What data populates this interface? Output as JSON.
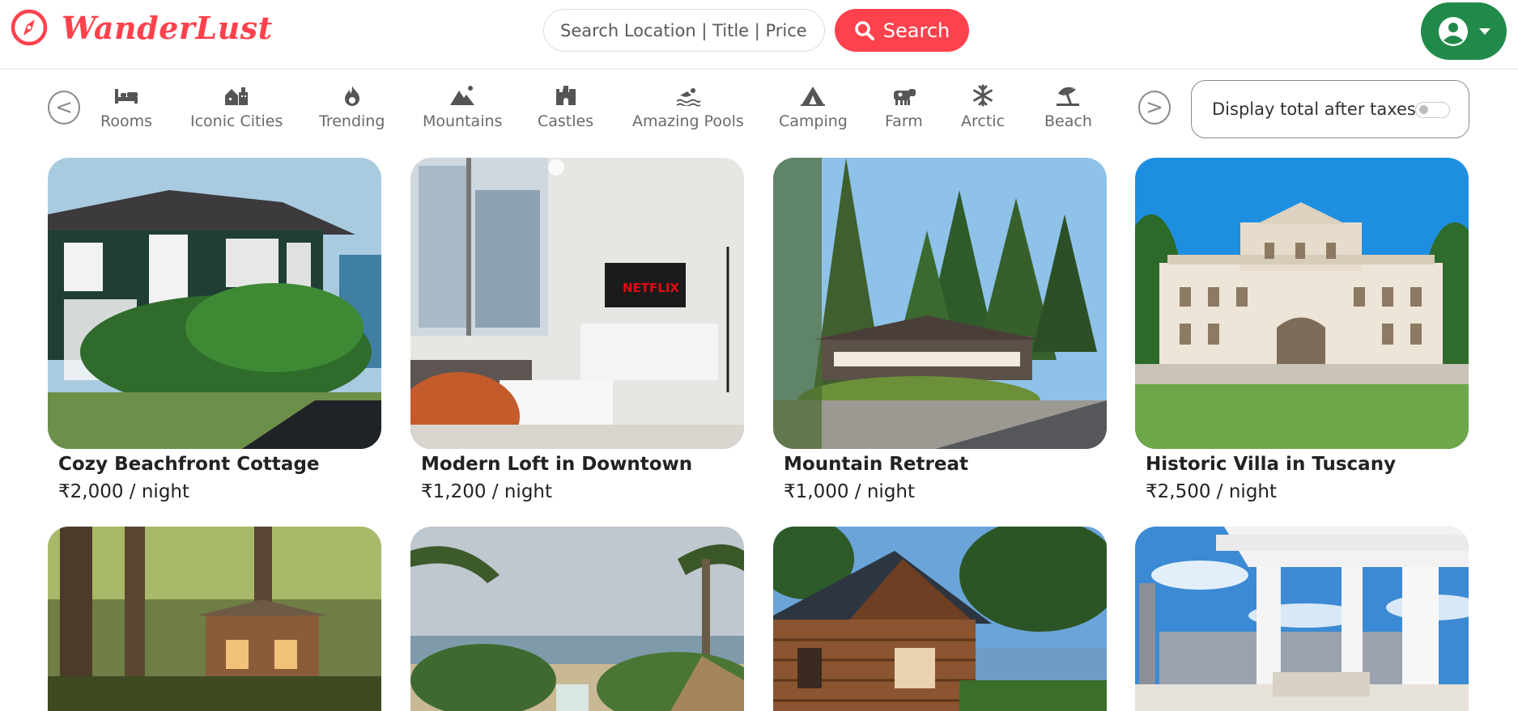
{
  "navbar": {
    "brand_name": "WanderLust",
    "search_placeholder": "Search Location | Title | Price",
    "search_button_label": "Search"
  },
  "filters": {
    "items": [
      {
        "label": "Rooms",
        "icon": "bed-icon"
      },
      {
        "label": "Iconic Cities",
        "icon": "city-icon"
      },
      {
        "label": "Trending",
        "icon": "fire-icon"
      },
      {
        "label": "Mountains",
        "icon": "mountain-icon"
      },
      {
        "label": "Castles",
        "icon": "castle-icon"
      },
      {
        "label": "Amazing Pools",
        "icon": "swimmer-icon"
      },
      {
        "label": "Camping",
        "icon": "tent-icon"
      },
      {
        "label": "Farm",
        "icon": "cow-icon"
      },
      {
        "label": "Arctic",
        "icon": "snowflake-icon"
      },
      {
        "label": "Beach",
        "icon": "umbrella-beach-icon"
      }
    ],
    "prev_label": "<",
    "next_label": ">",
    "tax_toggle_label": "Display total after taxes"
  },
  "listings": [
    {
      "title": "Cozy Beachfront Cottage",
      "price": "₹2,000 / night",
      "image": "cottage"
    },
    {
      "title": "Modern Loft in Downtown",
      "price": "₹1,200 / night",
      "image": "loft"
    },
    {
      "title": "Mountain Retreat",
      "price": "₹1,000 / night",
      "image": "retreat"
    },
    {
      "title": "Historic Villa in Tuscany",
      "price": "₹2,500 / night",
      "image": "villa"
    },
    {
      "title": "",
      "price": "",
      "image": "treehouse"
    },
    {
      "title": "",
      "price": "",
      "image": "beach-palms"
    },
    {
      "title": "",
      "price": "",
      "image": "log-cabin"
    },
    {
      "title": "",
      "price": "",
      "image": "penthouse"
    }
  ],
  "colors": {
    "brand": "#fe424d",
    "profile": "#218a4a"
  }
}
